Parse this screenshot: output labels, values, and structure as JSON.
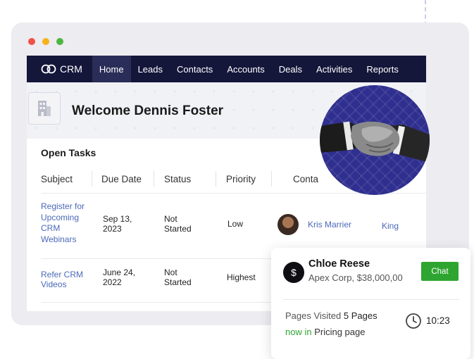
{
  "navbar": {
    "brand": "CRM",
    "items": [
      "Home",
      "Leads",
      "Contacts",
      "Accounts",
      "Deals",
      "Activities",
      "Reports"
    ],
    "active": "Home"
  },
  "header": {
    "welcome": "Welcome Dennis Foster"
  },
  "tasks": {
    "title": "Open Tasks",
    "columns": [
      "Subject",
      "Due Date",
      "Status",
      "Priority",
      "Conta"
    ],
    "rows": [
      {
        "subject": "Register for Upcoming CRM Webinars",
        "due_date": "Sep 13, 2023",
        "status": "Not Started",
        "priority": "Low",
        "contact": "Kris Marrier",
        "account": "King"
      },
      {
        "subject": "Refer CRM Videos",
        "due_date": "June 24, 2022",
        "status": "Not Started",
        "priority": "Highest"
      }
    ]
  },
  "popup": {
    "name": "Chloe Reese",
    "company": "Apex Corp, $38,000,00",
    "chat_label": "Chat",
    "pages_visited_label": "Pages Visited",
    "pages_visited_value": "5 Pages",
    "now_in_label": "now in",
    "now_in_page": "Pricing page",
    "time": "10:23"
  },
  "icons": {
    "window_dots": [
      "#ef5246",
      "#f6b21b",
      "#4cb63f"
    ],
    "brand_icon": "crm-logo-icon",
    "building": "building-icon",
    "dollar": "dollar-icon",
    "clock": "clock-icon"
  },
  "colors": {
    "navbar": "#14163a",
    "link": "#4a69b8",
    "chat_button": "#2ea530",
    "circle": "#2f2f8f"
  }
}
